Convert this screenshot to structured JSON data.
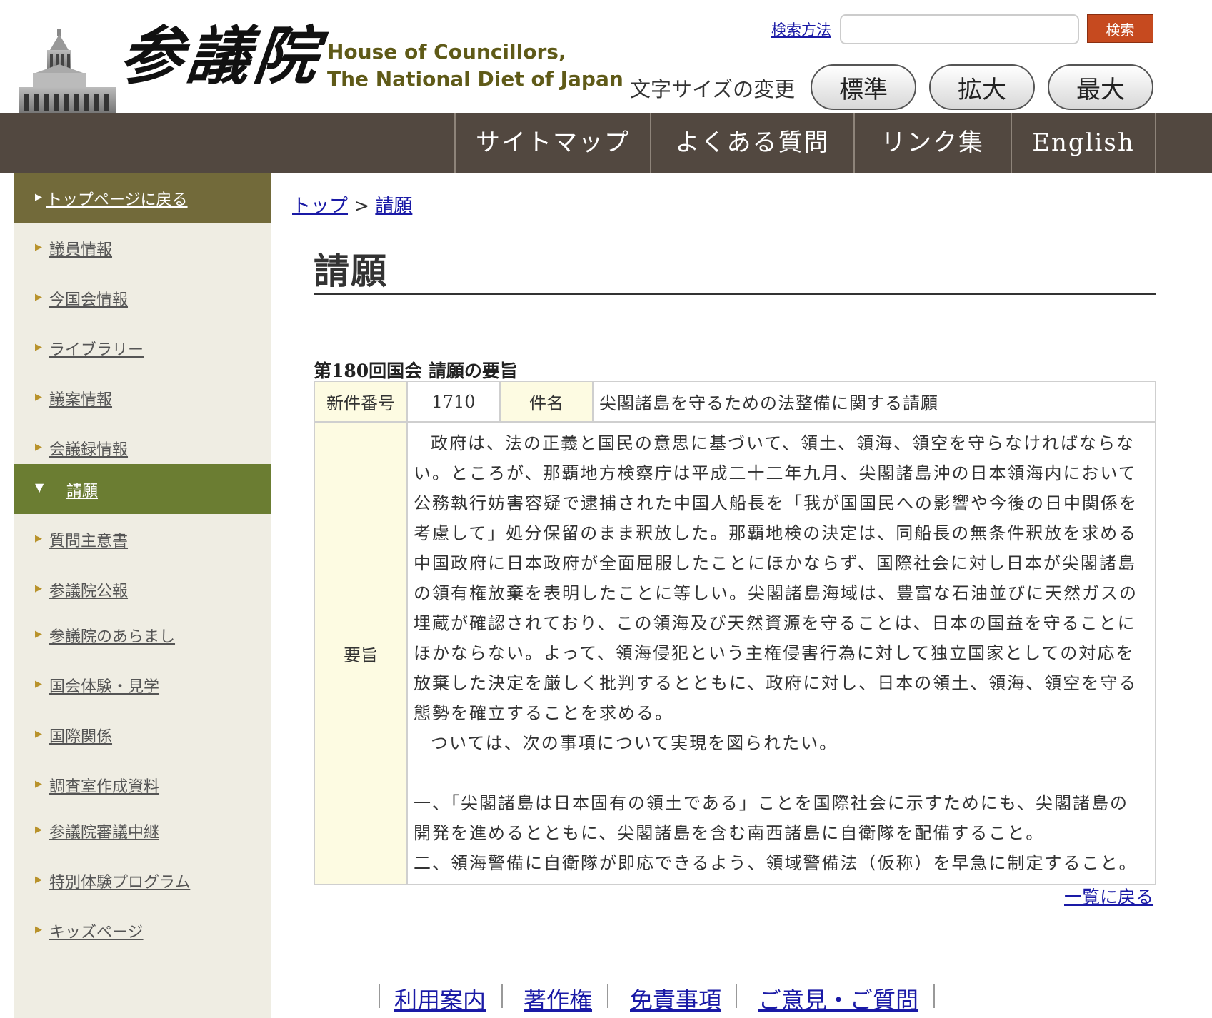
{
  "header": {
    "logo_kanji": "参議院",
    "logo_en_line1": "House of Councillors,",
    "logo_en_line2": "The National Diet of Japan",
    "search_method": "検索方法",
    "search_placeholder": "",
    "search_button": "検索",
    "font_size_label": "文字サイズの変更",
    "size_standard": "標準",
    "size_large": "拡大",
    "size_max": "最大"
  },
  "topnav": {
    "sitemap": "サイトマップ",
    "faq": "よくある質問",
    "links": "リンク集",
    "english": "English"
  },
  "sidebar": {
    "items": [
      {
        "label": "トップページに戻る"
      },
      {
        "label": "議員情報"
      },
      {
        "label": "今国会情報"
      },
      {
        "label": "ライブラリー"
      },
      {
        "label": "議案情報"
      },
      {
        "label": "会議録情報"
      },
      {
        "label": "請願"
      },
      {
        "label": "質問主意書"
      },
      {
        "label": "参議院公報"
      },
      {
        "label": "参議院のあらまし"
      },
      {
        "label": "国会体験・見学"
      },
      {
        "label": "国際関係"
      },
      {
        "label": "調査室作成資料"
      },
      {
        "label": "参議院審議中継"
      },
      {
        "label": "特別体験プログラム"
      },
      {
        "label": "キッズページ"
      }
    ]
  },
  "breadcrumb": {
    "top": "トップ",
    "separator": ">",
    "current": "請願"
  },
  "main": {
    "title": "請願",
    "section_heading": "第180回国会 請願の要旨",
    "table": {
      "number_label": "新件番号",
      "number": "1710",
      "subject_label": "件名",
      "subject": "尖閣諸島を守るための法整備に関する請願",
      "gist_label": "要旨",
      "gist_lines": [
        "政府は、法の正義と国民の意思に基づいて、領土、領海、領空を守らなければならない。ところが、那覇地方検察庁は平成二十二年九月、尖閣諸島沖の日本領海内において公務執行妨害容疑で逮捕された中国人船長を「我が国国民への影響や今後の日中関係を考慮して」処分保留のまま釈放した。那覇地検の決定は、同船長の無条件釈放を求める中国政府に日本政府が全面屈服したことにほかならず、国際社会に対し日本が尖閣諸島の領有権放棄を表明したことに等しい。尖閣諸島海域は、豊富な石油並びに天然ガスの埋蔵が確認されており、この領海及び天然資源を守ることは、日本の国益を守ることにほかならない。よって、領海侵犯という主権侵害行為に対して独立国家としての対応を放棄した決定を厳しく批判するとともに、政府に対し、日本の領土、領海、領空を守る態勢を確立することを求める。",
        "ついては、次の事項について実現を図られたい。",
        "一、「尖閣諸島は日本固有の領土である」ことを国際社会に示すためにも、尖閣諸島の開発を進めるとともに、尖閣諸島を含む南西諸島に自衛隊を配備すること。",
        "二、領海警備に自衛隊が即応できるよう、領域警備法（仮称）を早急に制定すること。"
      ]
    },
    "back_to_list": "一覧に戻る"
  },
  "footer": {
    "links": [
      "利用案内",
      "著作権",
      "免責事項",
      "ご意見・ご質問"
    ]
  },
  "colors": {
    "nav_bg": "#524840",
    "sidebar_bg": "#efede3",
    "sidebar_top_bg": "#726a3a",
    "sidebar_active_bg": "#6b7d32",
    "search_button_bg": "#c64a1f",
    "table_header_bg": "#fdfbe2",
    "link": "#1a1aa6"
  }
}
